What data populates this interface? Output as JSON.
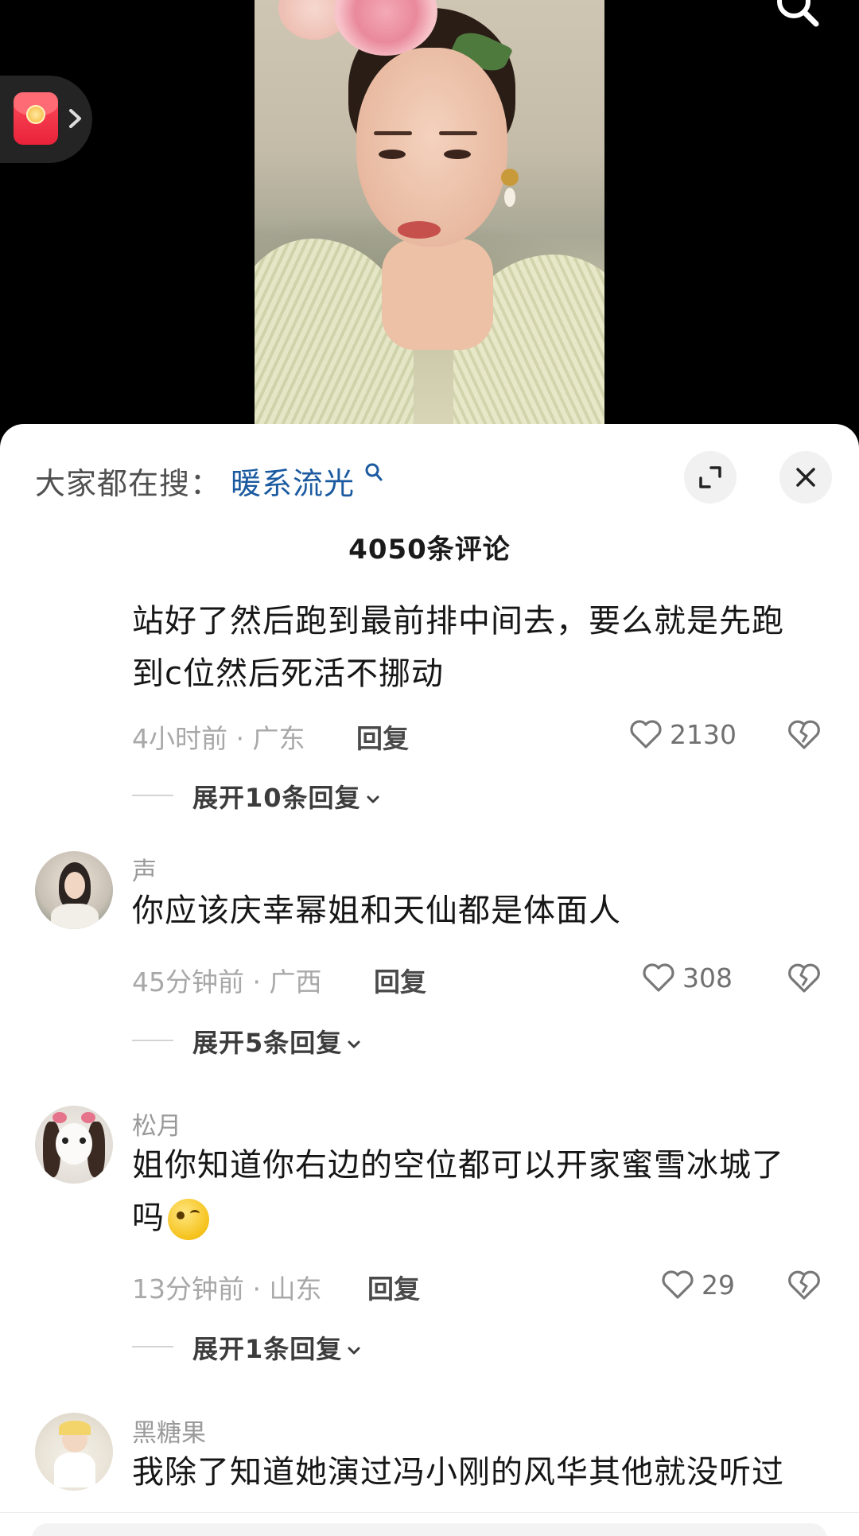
{
  "video": {
    "description_alt": ""
  },
  "header": {
    "trending_prefix": "大家都在搜：",
    "trending_term": "暖系流光"
  },
  "comment_count": "4050条评论",
  "comments": [
    {
      "username": "",
      "text": "站好了然后跑到最前排中间去，要么就是先跑到c位然后死活不挪动",
      "meta": "4小时前 · 广东",
      "reply_label": "回复",
      "likes": "2130",
      "expand": "展开10条回复"
    },
    {
      "username": "声",
      "text": "你应该庆幸幂姐和天仙都是体面人",
      "meta": "45分钟前 · 广西",
      "reply_label": "回复",
      "likes": "308",
      "expand": "展开5条回复"
    },
    {
      "username": "松月",
      "text": "姐你知道你右边的空位都可以开家蜜雪冰城了吗",
      "meta": "13分钟前 · 山东",
      "reply_label": "回复",
      "likes": "29",
      "expand": "展开1条回复"
    },
    {
      "username": "黑糖果",
      "text": "我除了知道她演过冯小刚的风华其他就没听过"
    }
  ],
  "colors": {
    "accent_link": "#1b5aa0",
    "redpacket": "#e8223a"
  },
  "icons": [
    "search-icon",
    "red-packet-icon",
    "chevron-right-icon",
    "expand-icon",
    "close-icon",
    "heart-icon",
    "broken-heart-icon",
    "chevron-down-icon"
  ]
}
